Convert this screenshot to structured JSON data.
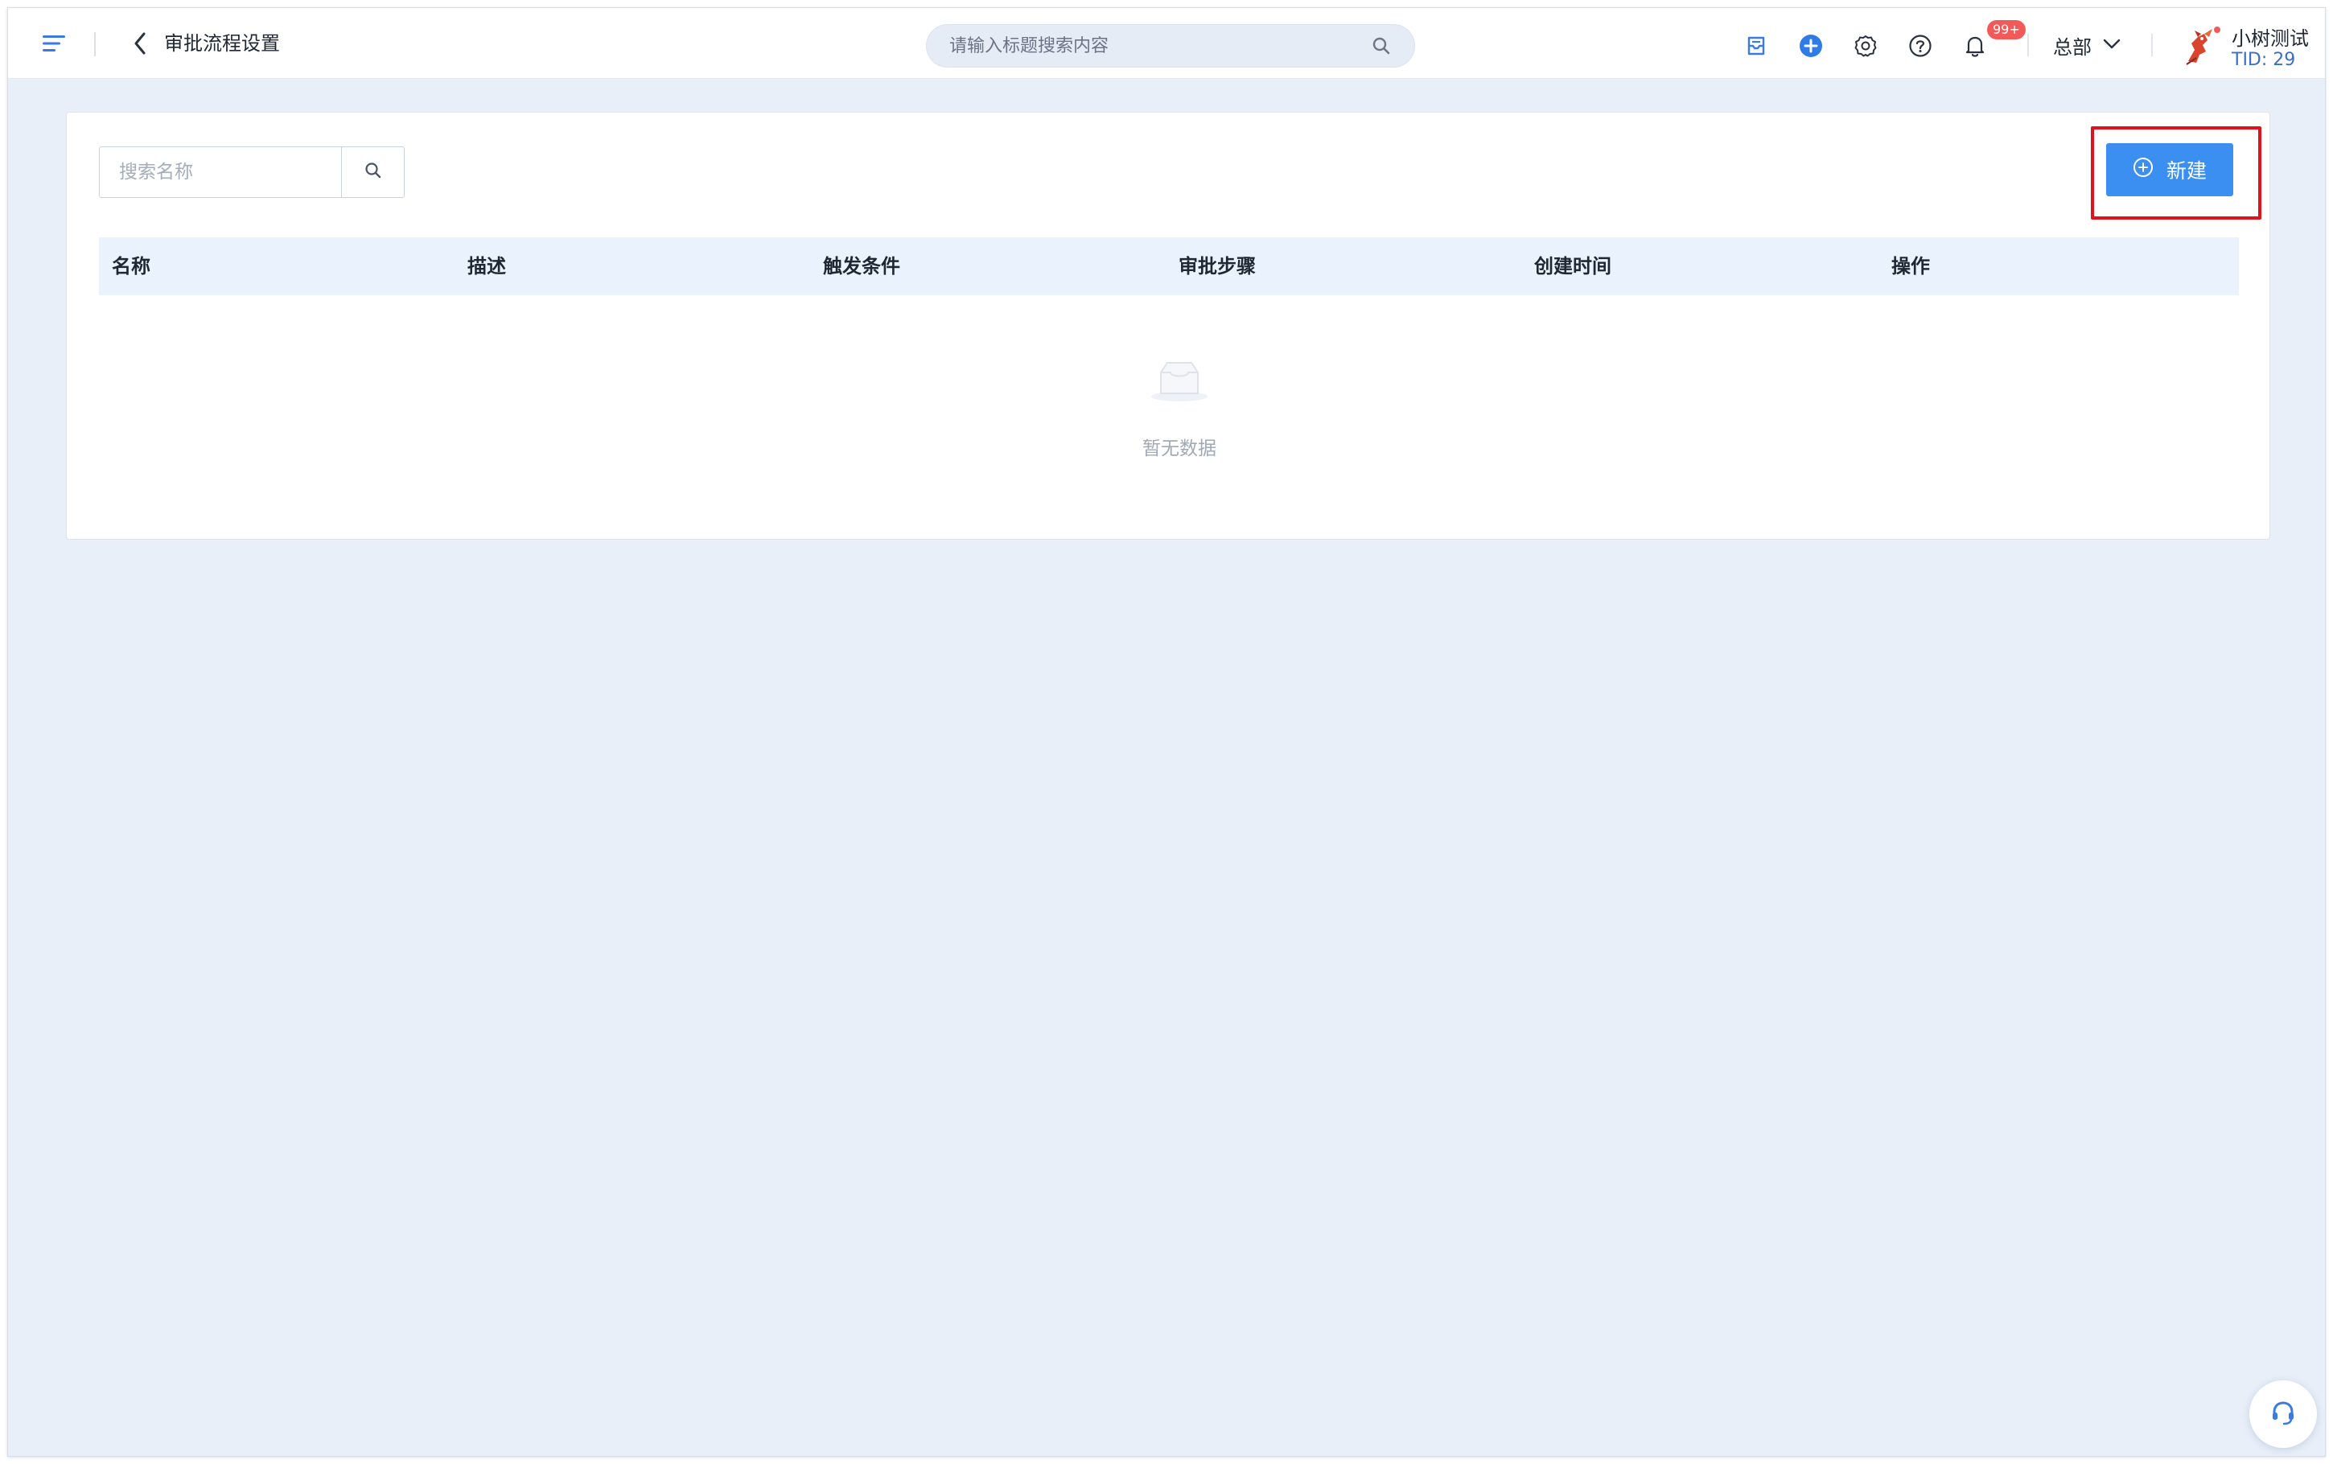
{
  "header": {
    "page_title": "审批流程设置",
    "search_placeholder": "请输入标题搜索内容",
    "notification_badge": "99+",
    "org_label": "总部",
    "user_name": "小树测试",
    "user_tid": "TID: 29"
  },
  "icons": {
    "menu": "menu-icon",
    "back": "chevron-left-icon",
    "search": "search-icon",
    "inbox": "inbox-icon",
    "add": "plus-circle-icon",
    "settings": "gear-icon",
    "help": "question-circle-icon",
    "notifications": "bell-icon",
    "org_dropdown": "chevron-down-icon",
    "support": "headset-icon"
  },
  "toolbar": {
    "search_placeholder": "搜索名称",
    "new_button_label": "新建"
  },
  "table": {
    "columns": [
      "名称",
      "描述",
      "触发条件",
      "审批步骤",
      "创建时间",
      "操作"
    ],
    "rows": [],
    "empty_text": "暂无数据"
  },
  "colors": {
    "primary": "#3b8ff0",
    "highlight_border": "#e0121c",
    "badge": "#f25a5a",
    "page_background": "#e8eff9",
    "table_header_background": "#eaf3fd"
  }
}
